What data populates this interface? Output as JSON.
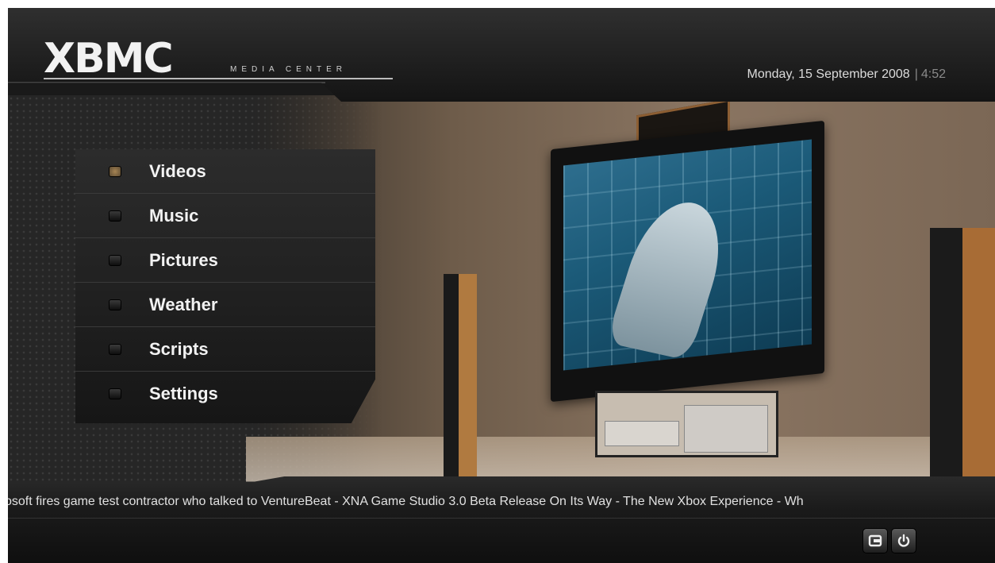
{
  "header": {
    "logo_text": "XBMC",
    "logo_subtitle": "MEDIA CENTER",
    "date": "Monday, 15 September 2008",
    "separator": "|",
    "time": "4:52"
  },
  "menu": {
    "items": [
      {
        "label": "Videos",
        "active": true
      },
      {
        "label": "Music",
        "active": false
      },
      {
        "label": "Pictures",
        "active": false
      },
      {
        "label": "Weather",
        "active": false
      },
      {
        "label": "Scripts",
        "active": false
      },
      {
        "label": "Settings",
        "active": false
      }
    ]
  },
  "ticker": {
    "text": "osoft fires game test contractor who talked to VentureBeat - XNA Game Studio 3.0 Beta Release On Its Way - The New Xbox Experience - Wh"
  },
  "footer": {
    "buttons": [
      {
        "icon": "minimize-icon"
      },
      {
        "icon": "power-icon"
      }
    ]
  },
  "colors": {
    "accent": "#a68454",
    "text": "#f2f2f2",
    "panel": "#1e1e1e"
  }
}
